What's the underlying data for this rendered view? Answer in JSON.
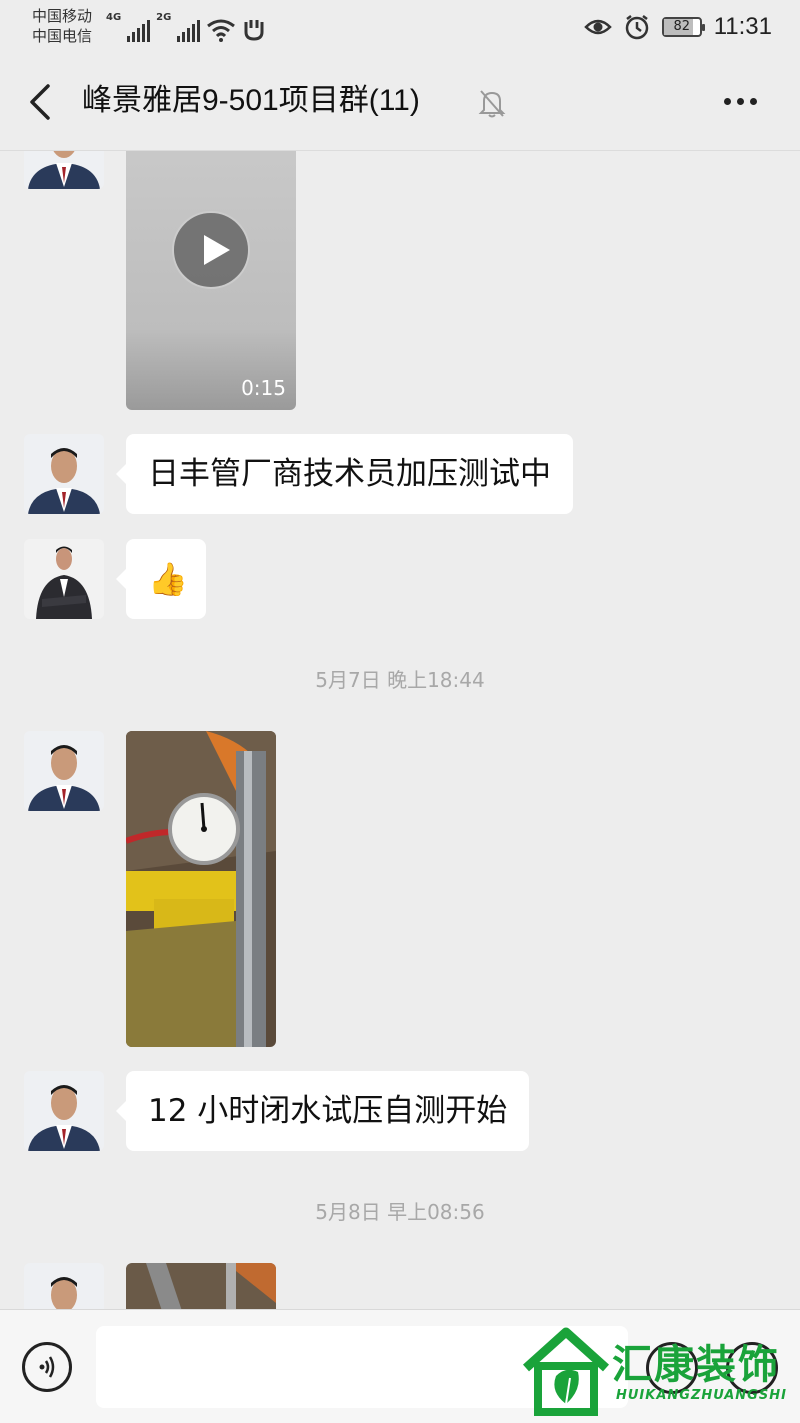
{
  "status_bar": {
    "carrier_1": "中国移动",
    "carrier_2": "中国电信",
    "net_1": "4G",
    "net_2": "2G",
    "battery": "82",
    "time": "11:31"
  },
  "nav": {
    "title": "峰景雅居9-501项目群(11)"
  },
  "messages": [
    {
      "type": "video",
      "duration": "0:15"
    },
    {
      "type": "text",
      "text": "日丰管厂商技术员加压测试中"
    },
    {
      "type": "emoji",
      "text": "👍"
    },
    {
      "type": "timestamp",
      "text": "5月7日 晚上18:44"
    },
    {
      "type": "image"
    },
    {
      "type": "text",
      "text": "12 小时闭水试压自测开始"
    },
    {
      "type": "timestamp",
      "text": "5月8日 早上08:56"
    },
    {
      "type": "image"
    }
  ],
  "input_bar": {
    "message_value": ""
  },
  "watermark": {
    "brand": "汇康装饰",
    "brand_pinyin": "HUIKANGZHUANGSHI",
    "color": "#1aa33a"
  }
}
